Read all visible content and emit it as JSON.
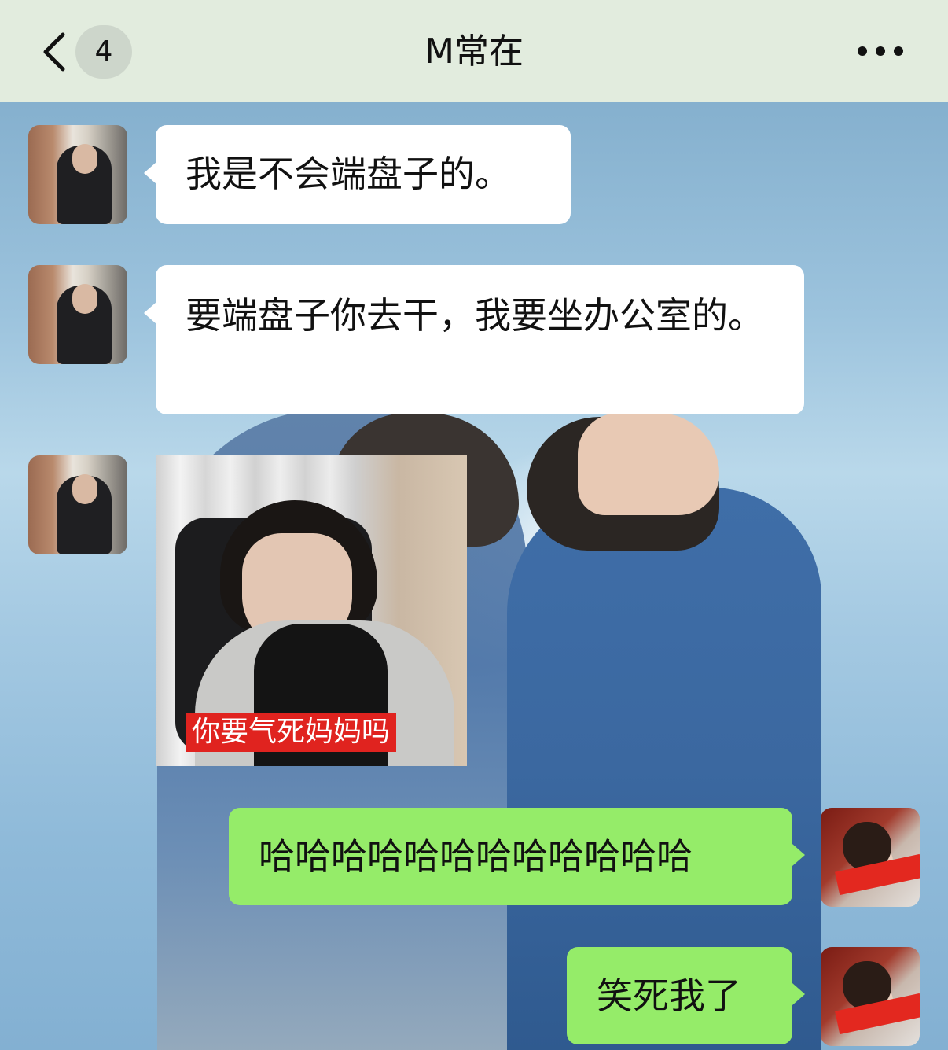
{
  "header": {
    "back_icon": "chevron-left-icon",
    "unread_count": "4",
    "title": "M常在",
    "more_icon": "more-dots-icon"
  },
  "colors": {
    "header_bg": "#e2ecde",
    "incoming_bubble": "#ffffff",
    "outgoing_bubble": "#95ec69",
    "caption_bg": "#e0231f"
  },
  "messages": [
    {
      "sender": "other",
      "type": "text",
      "text": "我是不会端盘子的。"
    },
    {
      "sender": "other",
      "type": "text",
      "text": "要端盘子你去干，我要坐办公室的。"
    },
    {
      "sender": "other",
      "type": "sticker",
      "caption": "你要气死妈妈吗"
    },
    {
      "sender": "self",
      "type": "text",
      "text": "哈哈哈哈哈哈哈哈哈哈哈哈"
    },
    {
      "sender": "self",
      "type": "text",
      "text": "笑死我了"
    }
  ]
}
